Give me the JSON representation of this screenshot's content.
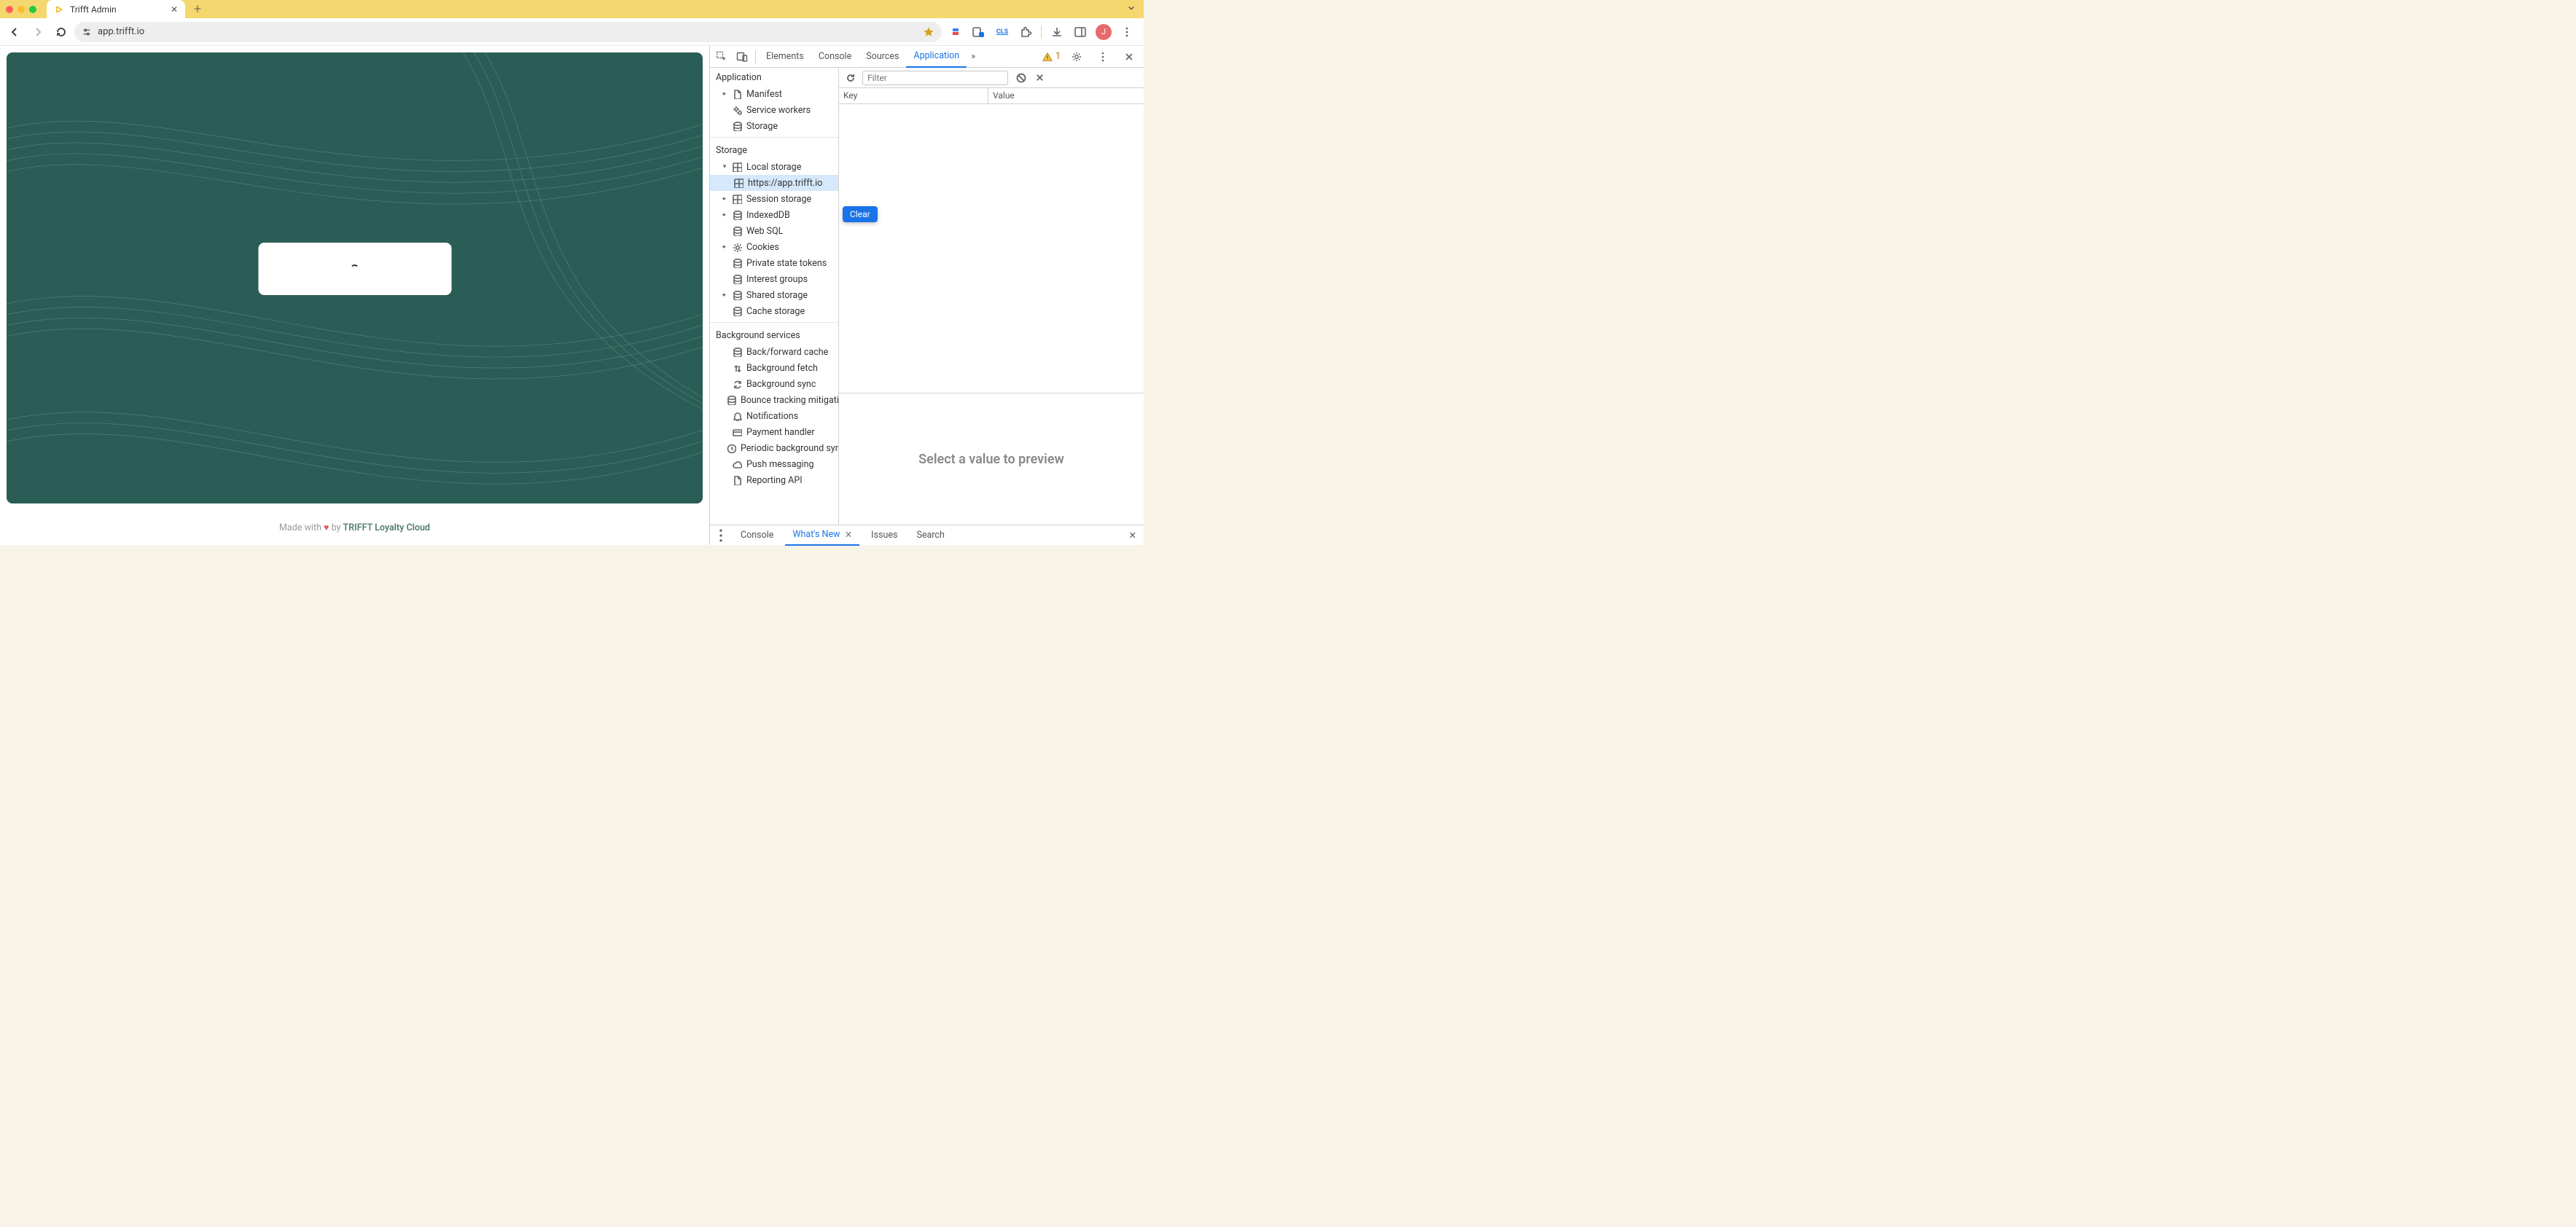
{
  "browser": {
    "tab_title": "Trifft Admin",
    "url": "app.trifft.io"
  },
  "page": {
    "footer_prefix": "Made with",
    "footer_by": "by",
    "footer_brand": "TRIFFT Loyalty Cloud"
  },
  "devtools": {
    "tabs": [
      "Elements",
      "Console",
      "Sources",
      "Application"
    ],
    "active_tab": "Application",
    "issue_count": "1",
    "filter_placeholder": "Filter",
    "tooltip": "Clear",
    "kv": {
      "key_header": "Key",
      "value_header": "Value"
    },
    "preview_text": "Select a value to preview",
    "tree": {
      "application_title": "Application",
      "application_items": [
        "Manifest",
        "Service workers",
        "Storage"
      ],
      "storage_title": "Storage",
      "storage_items": {
        "local_storage": "Local storage",
        "local_storage_child": "https://app.trifft.io",
        "session_storage": "Session storage",
        "indexeddb": "IndexedDB",
        "websql": "Web SQL",
        "cookies": "Cookies",
        "private_state": "Private state tokens",
        "interest_groups": "Interest groups",
        "shared_storage": "Shared storage",
        "cache_storage": "Cache storage"
      },
      "bg_title": "Background services",
      "bg_items": [
        "Back/forward cache",
        "Background fetch",
        "Background sync",
        "Bounce tracking mitigations",
        "Notifications",
        "Payment handler",
        "Periodic background sync",
        "Push messaging",
        "Reporting API"
      ]
    },
    "drawer": {
      "tabs": [
        "Console",
        "What's New",
        "Issues",
        "Search"
      ],
      "active": "What's New"
    }
  }
}
